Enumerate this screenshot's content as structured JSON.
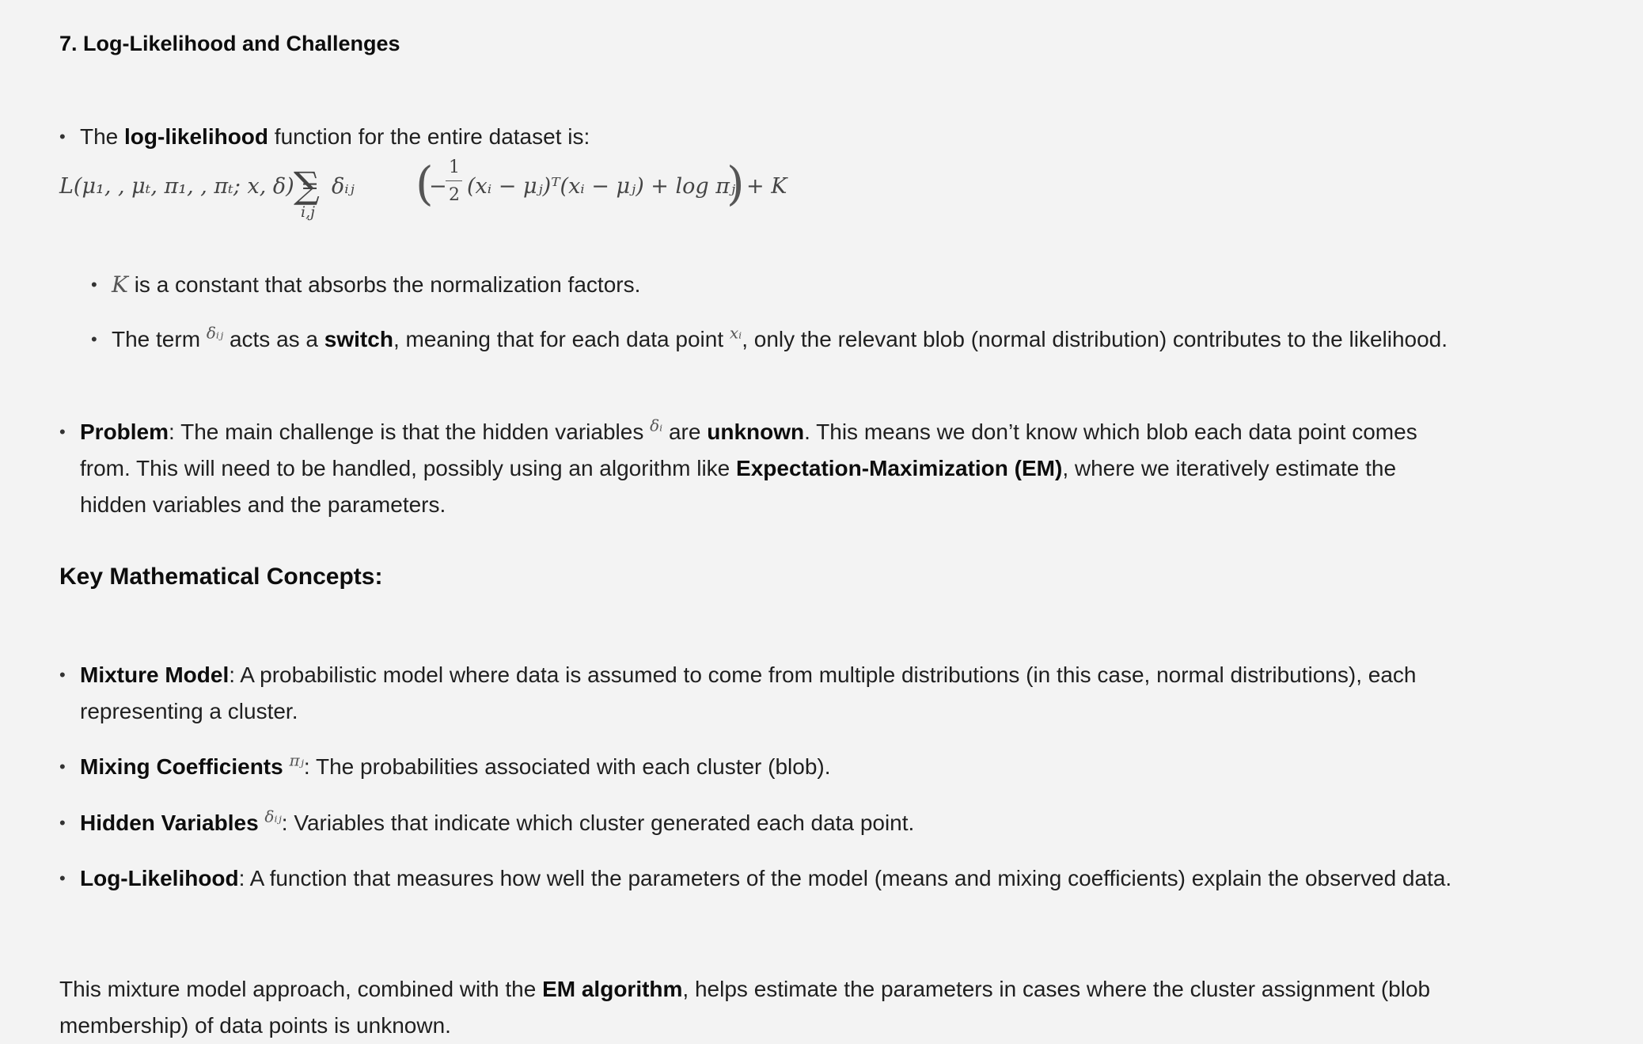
{
  "section": {
    "title": "7. Log-Likelihood and Challenges"
  },
  "loglik_intro": {
    "pre": "The ",
    "bold": "log-likelihood",
    "post": " function for the entire dataset is:"
  },
  "equation": {
    "lhs": "L(μ₁, , μₜ, π₁, , πₜ; x, δ) =",
    "sigma": "∑",
    "sigma_sub": "i,j",
    "delta": "δᵢⱼ",
    "open_paren": "(",
    "minus": "−",
    "frac_num": "1",
    "frac_den": "2",
    "body": "(xᵢ − μⱼ)ᵀ(xᵢ − μⱼ) + log πⱼ",
    "close_paren": ")",
    "tail": "+ K"
  },
  "sub_items": [
    {
      "symbol": "K",
      "text": " is a constant that absorbs the normalization factors."
    },
    {
      "pre": "The term ",
      "symbol": "δᵢⱼ",
      "mid1": " acts as a ",
      "bold": "switch",
      "mid2": ", meaning that for each data point ",
      "symbol2": "xᵢ",
      "post": ", only the relevant blob (normal distribution) contributes to the likelihood."
    }
  ],
  "problem": {
    "bold": "Problem",
    "text1": ": The main challenge is that the hidden variables ",
    "symbol": "δᵢ",
    "text2": " are ",
    "bold2": "unknown",
    "text3": ". This means we don’t know which blob each data point comes from. This will need to be handled, possibly using an algorithm like ",
    "bold3": "Expectation-Maximization (EM)",
    "text4": ", where we iteratively estimate the hidden variables and the parameters."
  },
  "concepts": {
    "title": "Key Mathematical Concepts:",
    "items": [
      {
        "term": "Mixture Model",
        "symbol": "",
        "desc": ": A probabilistic model where data is assumed to come from multiple distributions (in this case, normal distributions), each representing a cluster."
      },
      {
        "term": "Mixing Coefficients",
        "symbol": "πⱼ",
        "desc": ": The probabilities associated with each cluster (blob)."
      },
      {
        "term": "Hidden Variables",
        "symbol": "δᵢⱼ",
        "desc": ": Variables that indicate which cluster generated each data point."
      },
      {
        "term": "Log-Likelihood",
        "symbol": "",
        "desc": ": A function that measures how well the parameters of the model (means and mixing coefficients) explain the observed data."
      }
    ]
  },
  "closing": {
    "pre": "This mixture model approach, combined with the ",
    "bold": "EM algorithm",
    "post": ", helps estimate the parameters in cases where the cluster assignment (blob membership) of data points is unknown."
  }
}
